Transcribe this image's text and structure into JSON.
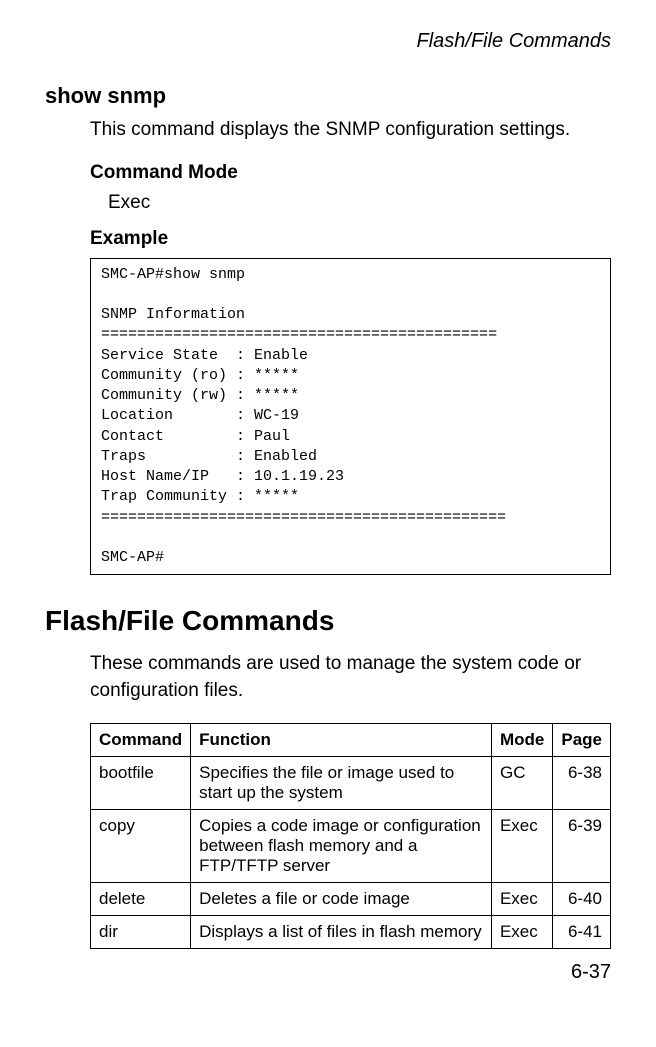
{
  "header": {
    "running": "Flash/File Commands"
  },
  "command": {
    "name": "show snmp",
    "description": "This command displays the SNMP configuration settings.",
    "mode_label": "Command Mode",
    "mode_value": "Exec",
    "example_label": "Example",
    "example_output": "SMC-AP#show snmp\n\nSNMP Information\n============================================\nService State  : Enable\nCommunity (ro) : *****\nCommunity (rw) : *****\nLocation       : WC-19\nContact        : Paul\nTraps          : Enabled\nHost Name/IP   : 10.1.19.23\nTrap Community : *****\n=============================================\n\nSMC-AP#"
  },
  "section": {
    "title": "Flash/File Commands",
    "intro": "These commands are used to manage the system code or configuration files."
  },
  "table": {
    "headers": {
      "command": "Command",
      "function": "Function",
      "mode": "Mode",
      "page": "Page"
    },
    "rows": [
      {
        "command": "bootfile",
        "function": "Specifies the file or image used to start up the system",
        "mode": "GC",
        "page": "6-38"
      },
      {
        "command": "copy",
        "function": "Copies a code image or configuration between flash memory and a FTP/TFTP server",
        "mode": "Exec",
        "page": "6-39"
      },
      {
        "command": "delete",
        "function": "Deletes a file or code image",
        "mode": "Exec",
        "page": "6-40"
      },
      {
        "command": "dir",
        "function": "Displays a list of files in flash memory",
        "mode": "Exec",
        "page": "6-41"
      }
    ]
  },
  "footer": {
    "page_number": "6-37"
  }
}
